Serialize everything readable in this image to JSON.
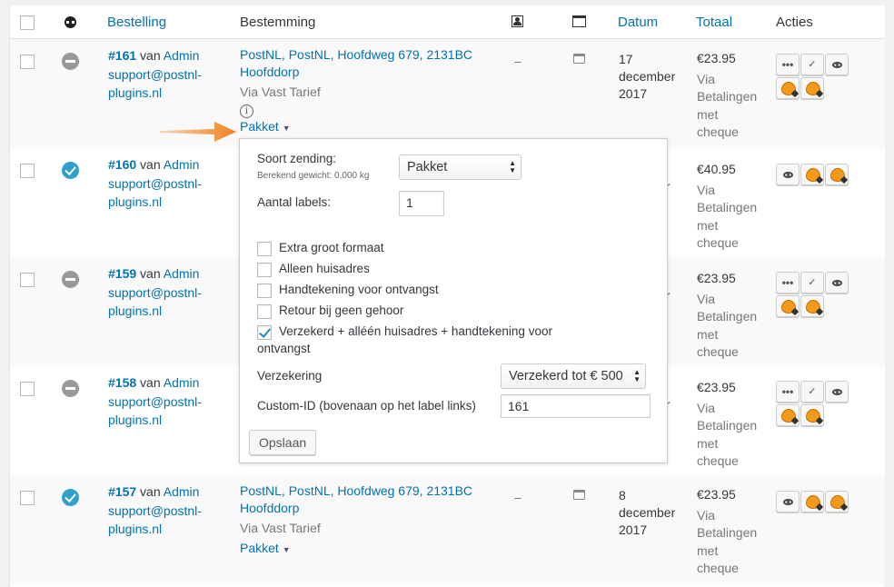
{
  "headers": {
    "order": "Bestelling",
    "destination": "Bestemming",
    "date": "Datum",
    "total": "Totaal",
    "actions": "Acties"
  },
  "colors": {
    "link": "#0073aa",
    "orange_arrow": "#f0821e",
    "status_processing": "#2ea2cc",
    "status_onhold": "#999999"
  },
  "rows": [
    {
      "status": "on-hold",
      "order_no": "#161",
      "van": "van",
      "customer": "Admin",
      "email": "support@postnl-plugins.nl",
      "address": "PostNL, PostNL, Hoofdweg 679, 2131BC Hoofddorp",
      "shipping": "Via Vast Tarief",
      "info_icon": "i",
      "shipment_type": "Pakket",
      "dash": "–",
      "date_day": "17",
      "date_month": "december",
      "date_year": "2017",
      "total": "€23.95",
      "payment": "Via Betalingen met cheque"
    },
    {
      "status": "processing",
      "order_no": "#160",
      "van": "van",
      "customer": "Admin",
      "email": "support@postnl-plugins.nl",
      "date_frag": "er",
      "total": "€40.95",
      "payment": "Via Betalingen met cheque"
    },
    {
      "status": "on-hold",
      "order_no": "#159",
      "van": "van",
      "customer": "Admin",
      "email": "support@postnl-plugins.nl",
      "date_frag": "er",
      "total": "€23.95",
      "payment": "Via Betalingen met cheque"
    },
    {
      "status": "on-hold",
      "order_no": "#158",
      "van": "van",
      "customer": "Admin",
      "email": "support@postnl-plugins.nl",
      "date_frag": "er",
      "total": "€23.95",
      "payment": "Via Betalingen met cheque"
    },
    {
      "status": "processing",
      "order_no": "#157",
      "van": "van",
      "customer": "Admin",
      "email": "support@postnl-plugins.nl",
      "address": "PostNL, PostNL, Hoofdweg 679, 2131BC Hoofddorp",
      "shipping": "Via Vast Tarief",
      "shipment_type": "Pakket",
      "dash": "–",
      "date_day": "8",
      "date_month": "december",
      "date_year": "2017",
      "total": "€23.95",
      "payment": "Via Betalingen met cheque"
    }
  ],
  "actions": {
    "more": "•••",
    "complete": "✓"
  },
  "popup": {
    "shipment_type_label": "Soort zending:",
    "weight_note": "Berekend gewicht: 0,000 kg",
    "shipment_type_value": "Pakket",
    "labels_count_label": "Aantal labels:",
    "labels_count_value": "1",
    "options": [
      {
        "label": "Extra groot formaat",
        "checked": false
      },
      {
        "label": "Alleen huisadres",
        "checked": false
      },
      {
        "label": "Handtekening voor ontvangst",
        "checked": false
      },
      {
        "label": "Retour bij geen gehoor",
        "checked": false
      },
      {
        "label": "Verzekerd + alléén huisadres + handtekening voor",
        "label_cont": "ontvangst",
        "checked": true
      }
    ],
    "insurance_label": "Verzekering",
    "insurance_value": "Verzekerd tot € 500",
    "custom_id_label": "Custom-ID (bovenaan op het label links)",
    "custom_id_value": "161",
    "save_label": "Opslaan"
  }
}
